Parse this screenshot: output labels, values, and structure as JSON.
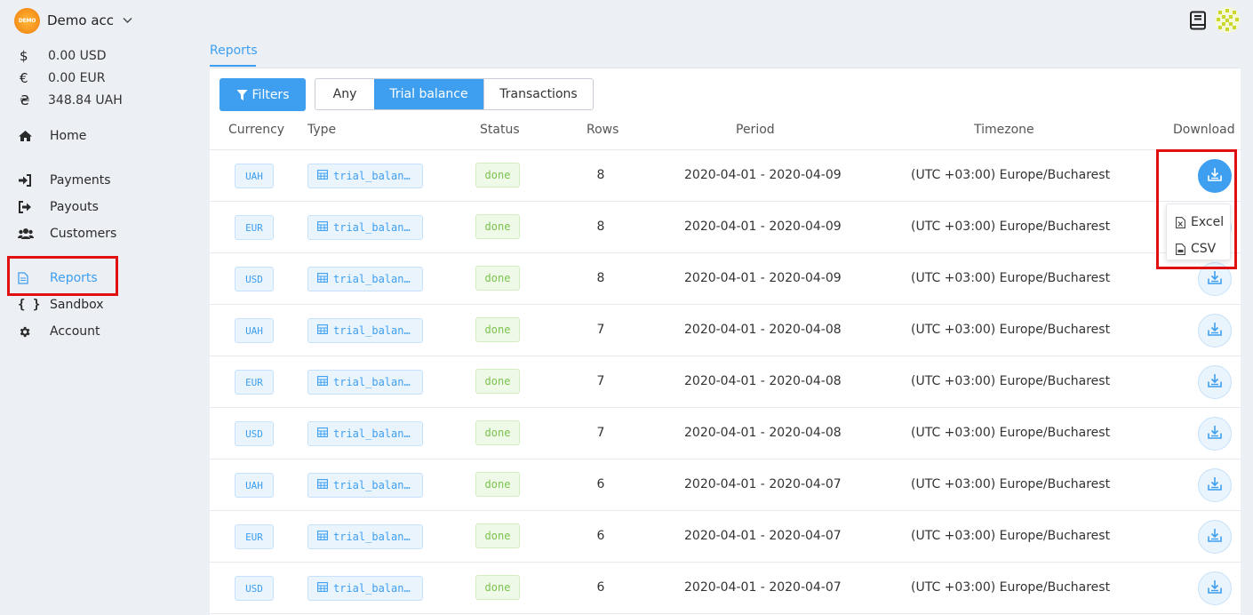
{
  "account": {
    "name": "Demo acc",
    "logo_text": "DEMO"
  },
  "balances": [
    {
      "symbol": "$",
      "amount": "0.00 USD"
    },
    {
      "symbol": "€",
      "amount": "0.00 EUR"
    },
    {
      "symbol": "₴",
      "amount": "348.84 UAH"
    }
  ],
  "nav": {
    "home": "Home",
    "payments": "Payments",
    "payouts": "Payouts",
    "customers": "Customers",
    "reports": "Reports",
    "sandbox": "Sandbox",
    "account": "Account"
  },
  "page_tab": "Reports",
  "toolbar": {
    "filters": "Filters",
    "segments": [
      "Any",
      "Trial balance",
      "Transactions"
    ],
    "selected_segment": "Trial balance"
  },
  "table": {
    "headers": [
      "Currency",
      "Type",
      "Status",
      "Rows",
      "Period",
      "Timezone",
      "Download"
    ],
    "rows": [
      {
        "currency": "UAH",
        "type": "trial_balan…",
        "status": "done",
        "rows": "8",
        "period": "2020-04-01 - 2020-04-09",
        "timezone": "(UTC +03:00) Europe/Bucharest"
      },
      {
        "currency": "EUR",
        "type": "trial_balan…",
        "status": "done",
        "rows": "8",
        "period": "2020-04-01 - 2020-04-09",
        "timezone": "(UTC +03:00) Europe/Bucharest"
      },
      {
        "currency": "USD",
        "type": "trial_balan…",
        "status": "done",
        "rows": "8",
        "period": "2020-04-01 - 2020-04-09",
        "timezone": "(UTC +03:00) Europe/Bucharest"
      },
      {
        "currency": "UAH",
        "type": "trial_balan…",
        "status": "done",
        "rows": "7",
        "period": "2020-04-01 - 2020-04-08",
        "timezone": "(UTC +03:00) Europe/Bucharest"
      },
      {
        "currency": "EUR",
        "type": "trial_balan…",
        "status": "done",
        "rows": "7",
        "period": "2020-04-01 - 2020-04-08",
        "timezone": "(UTC +03:00) Europe/Bucharest"
      },
      {
        "currency": "USD",
        "type": "trial_balan…",
        "status": "done",
        "rows": "7",
        "period": "2020-04-01 - 2020-04-08",
        "timezone": "(UTC +03:00) Europe/Bucharest"
      },
      {
        "currency": "UAH",
        "type": "trial_balan…",
        "status": "done",
        "rows": "6",
        "period": "2020-04-01 - 2020-04-07",
        "timezone": "(UTC +03:00) Europe/Bucharest"
      },
      {
        "currency": "EUR",
        "type": "trial_balan…",
        "status": "done",
        "rows": "6",
        "period": "2020-04-01 - 2020-04-07",
        "timezone": "(UTC +03:00) Europe/Bucharest"
      },
      {
        "currency": "USD",
        "type": "trial_balan…",
        "status": "done",
        "rows": "6",
        "period": "2020-04-01 - 2020-04-07",
        "timezone": "(UTC +03:00) Europe/Bucharest"
      }
    ]
  },
  "download_menu": {
    "excel": "Excel",
    "csv": "CSV"
  },
  "colors": {
    "accent": "#3e9ff0",
    "highlight": "#e01010",
    "done_green": "#7bc24f"
  }
}
